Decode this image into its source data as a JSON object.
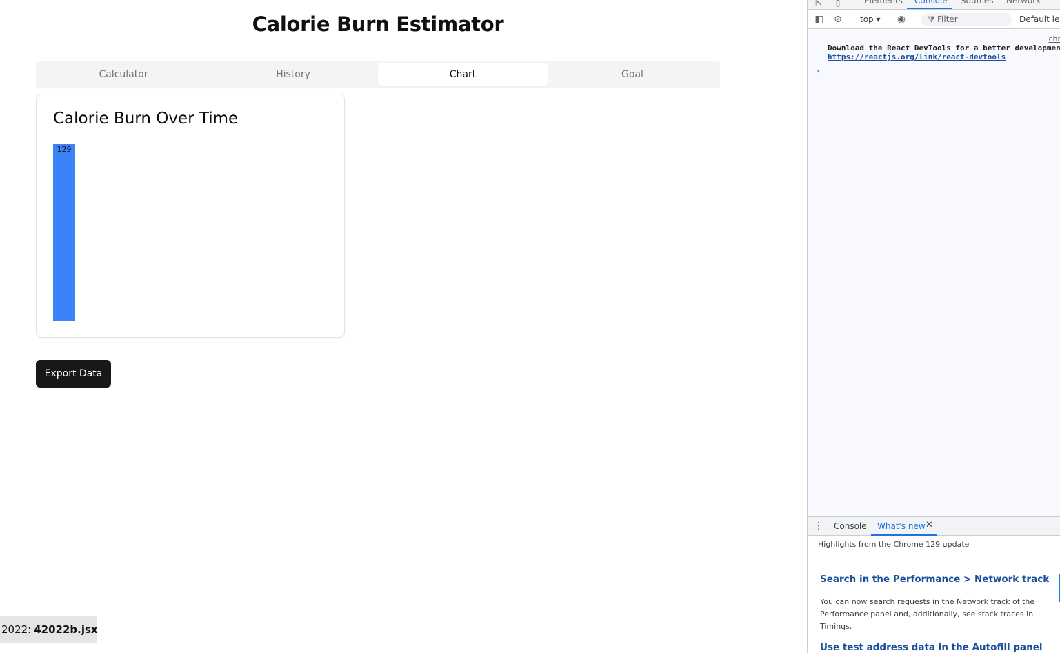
{
  "app": {
    "title": "Calorie Burn Estimator",
    "tabs": [
      {
        "label": "Calculator",
        "active": false
      },
      {
        "label": "History",
        "active": false
      },
      {
        "label": "Chart",
        "active": true
      },
      {
        "label": "Goal",
        "active": false
      }
    ],
    "card_title": "Calorie Burn Over Time",
    "export_label": "Export Data",
    "file_tag": {
      "prefix": "2022:",
      "name": "42022b.jsx"
    }
  },
  "chart_data": {
    "type": "bar",
    "categories": [
      ""
    ],
    "values": [
      129
    ],
    "data_labels": [
      "129"
    ],
    "bar_color": "#3b82f6",
    "ylim": [
      0,
      129
    ],
    "grid": false,
    "title": ""
  },
  "devtools": {
    "tabs": [
      "Elements",
      "Console",
      "Sources",
      "Network"
    ],
    "active_tab": "Console",
    "context": "top",
    "filter_placeholder": "Filter",
    "level": "Default lev",
    "source_link": "chr",
    "message_text": "Download the React DevTools for a better development",
    "message_link": "https://reactjs.org/link/react-devtools",
    "drawer_tabs": [
      "Console",
      "What's new"
    ],
    "active_drawer_tab": "What's new",
    "whats_new": {
      "header": "Highlights from the Chrome 129 update",
      "h1": "Search in the Performance > Network track",
      "p1": "You can now search requests in the Network track of the Performance panel and, additionally, see stack traces in Timings.",
      "h2": "Use test address data in the Autofill panel"
    }
  },
  "colors": {
    "accent": "#3b82f6",
    "button_bg": "#18181b",
    "devtools_blue": "#1a73e8"
  }
}
